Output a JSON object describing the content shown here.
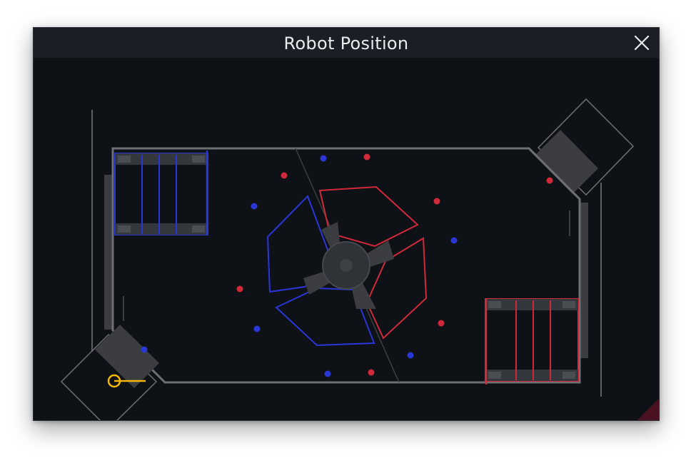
{
  "window": {
    "title": "Robot Position"
  },
  "icons": {
    "close": "close-icon",
    "robot": "robot-marker-icon"
  },
  "colors": {
    "blue_alliance": "#2a36d6",
    "red_alliance": "#d02a3a",
    "field_border": "#6d6f74",
    "robot": "#f2b705",
    "background": "#0e1115"
  }
}
